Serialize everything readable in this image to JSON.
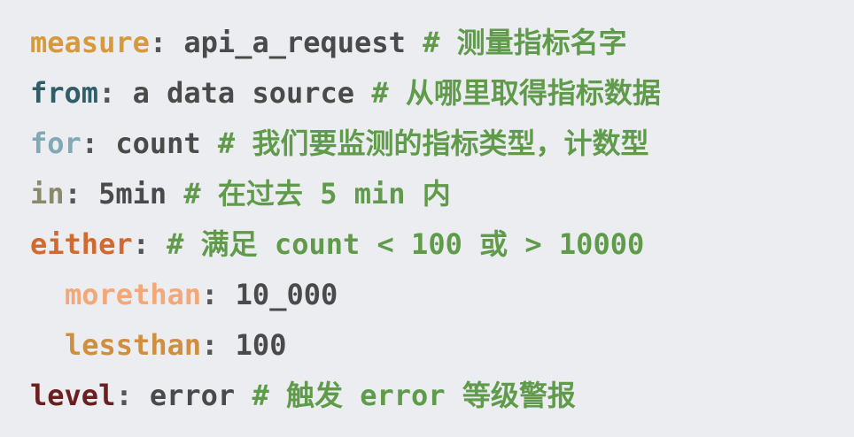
{
  "colors": {
    "background": "#ecedf0",
    "value_text": "#4a4a4a",
    "comment": "#5f9b4a"
  },
  "code_lines": [
    {
      "key": "measure",
      "sep": ":",
      "value": " api_a_request ",
      "comment": "# 测量指标名字",
      "key_color": "#d79a3b",
      "indented": false
    },
    {
      "key": "from",
      "sep": ":",
      "value": " a data source ",
      "comment": "# 从哪里取得指标数据",
      "key_color": "#2f5d68",
      "indented": false
    },
    {
      "key": "for",
      "sep": ":",
      "value": " count ",
      "comment": "# 我们要监测的指标类型，计数型",
      "key_color": "#7fa9b5",
      "indented": false
    },
    {
      "key": "in",
      "sep": ":",
      "value": " 5min ",
      "comment": "# 在过去 5 min 内",
      "key_color": "#8a8a6a",
      "indented": false
    },
    {
      "key": "either",
      "sep": ":",
      "value": " ",
      "comment": "# 满足 count < 100 或 > 10000",
      "key_color": "#d2692f",
      "indented": false
    },
    {
      "key": "morethan",
      "sep": ":",
      "value": " 10_000",
      "comment": "",
      "key_color": "#f2a878",
      "indented": true
    },
    {
      "key": "lessthan",
      "sep": ":",
      "value": " 100",
      "comment": "",
      "key_color": "#cf8f3e",
      "indented": true
    },
    {
      "key": "level",
      "sep": ":",
      "value": " error ",
      "comment": "# 触发 error 等级警报",
      "key_color": "#6b1f1f",
      "indented": false
    }
  ]
}
